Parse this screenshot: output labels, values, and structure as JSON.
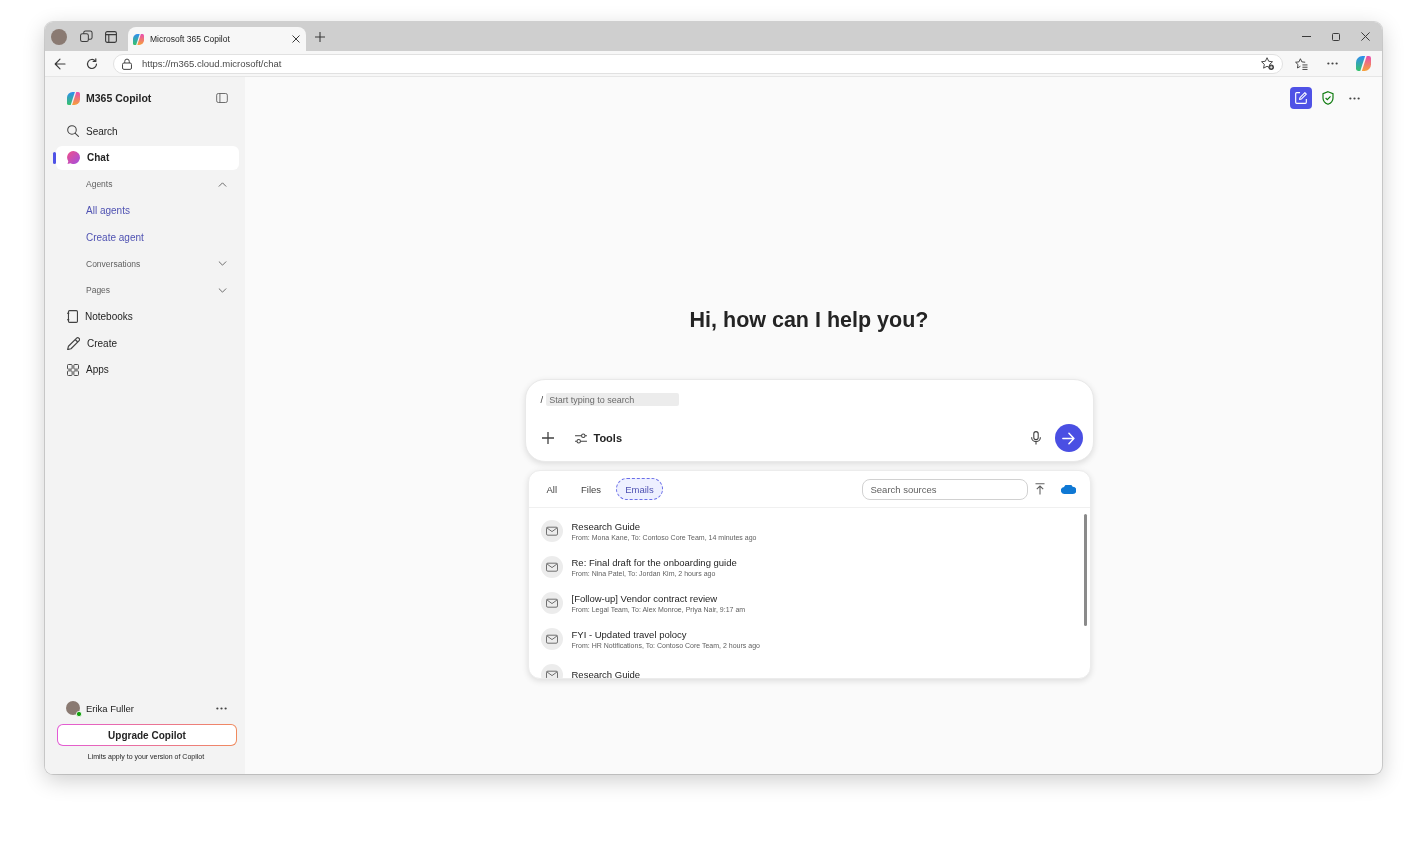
{
  "browser": {
    "tabs": [
      {
        "title": "Microsoft 365 Copilot",
        "selected": true
      }
    ],
    "address": "https://m365.cloud.microsoft/chat"
  },
  "sidebar": {
    "app_name": "M365 Copilot",
    "nav": [
      {
        "label": "Search",
        "selected": false
      },
      {
        "label": "Chat",
        "selected": true,
        "children": [
          {
            "label": "Agents",
            "expanded": true,
            "children": [
              {
                "label": "All agents"
              },
              {
                "label": "Create agent"
              }
            ]
          },
          {
            "label": "Conversations",
            "expanded": false
          },
          {
            "label": "Pages",
            "expanded": false
          }
        ]
      },
      {
        "label": "Notebooks",
        "selected": false
      },
      {
        "label": "Create",
        "selected": false
      },
      {
        "label": "Apps",
        "selected": false
      }
    ],
    "user": {
      "name": "Erika Fuller",
      "online": true
    },
    "upgrade_button": "Upgrade Copilot",
    "limits_note": "Limits apply to your version of Copilot"
  },
  "main": {
    "greeting": "Hi, how can I help you?",
    "composer": {
      "command": "/",
      "placeholder": "Start typing to search",
      "tools_label": "Tools"
    },
    "sources": {
      "tabs": [
        {
          "label": "All",
          "selected": false
        },
        {
          "label": "Files",
          "selected": false
        },
        {
          "label": "Emails",
          "selected": true
        }
      ],
      "search": {
        "placeholder": "Search sources"
      },
      "emails": [
        {
          "title": "Research Guide",
          "details": "From: Mona Kane, To: Contoso Core Team, 14 minutes ago"
        },
        {
          "title": "Re: Final draft for the onboarding guide",
          "details": "From: Nina Patel, To: Jordan Kim, 2 hours ago"
        },
        {
          "title": "[Follow-up] Vendor contract review",
          "details": "From: Legal Team, To: Alex Monroe, Priya Nair, 9:17 am"
        },
        {
          "title": "FYI - Updated travel polocy",
          "details": "From: HR Notifications, To: Contoso Core Team, 2 hours ago"
        },
        {
          "title": "Research Guide"
        }
      ]
    }
  }
}
